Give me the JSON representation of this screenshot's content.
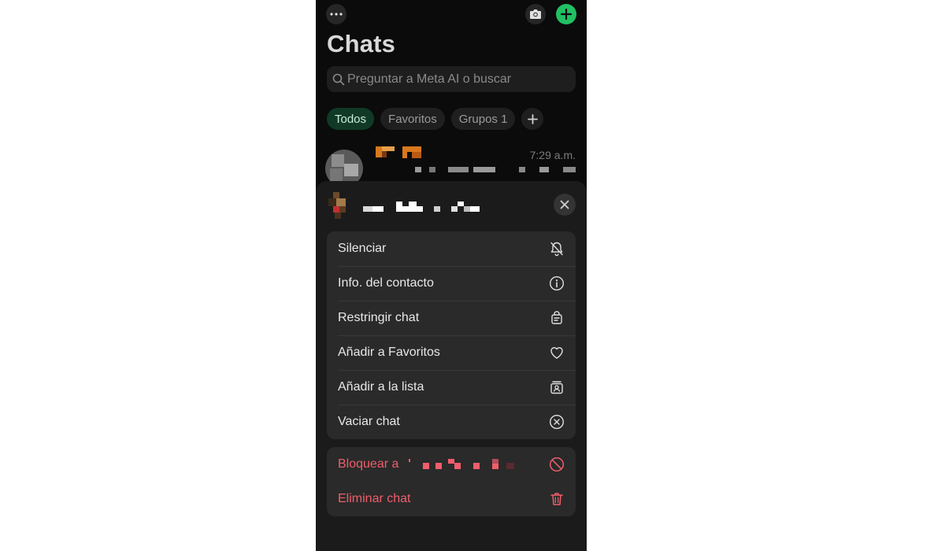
{
  "header": {
    "more_icon": "ellipsis-icon",
    "camera_icon": "camera-icon",
    "new_chat_icon": "plus-icon",
    "title": "Chats",
    "accent_color": "#21c063"
  },
  "search": {
    "placeholder": "Preguntar a Meta AI o buscar",
    "icon": "search-icon"
  },
  "filters": [
    {
      "label": "Todos",
      "active": true
    },
    {
      "label": "Favoritos",
      "active": false
    },
    {
      "label": "Grupos 1",
      "active": false
    },
    {
      "label": "+",
      "active": false
    }
  ],
  "chat_list": [
    {
      "time": "7:29 a.m."
    }
  ],
  "context_menu": {
    "close_icon": "close-icon",
    "options": [
      {
        "label": "Silenciar",
        "icon": "bell-off-icon"
      },
      {
        "label": "Info. del contacto",
        "icon": "info-icon"
      },
      {
        "label": "Restringir chat",
        "icon": "restrict-chat-icon"
      },
      {
        "label": "Añadir a Favoritos",
        "icon": "heart-icon"
      },
      {
        "label": "Añadir a la lista",
        "icon": "list-contact-icon"
      },
      {
        "label": "Vaciar chat",
        "icon": "clear-circle-icon"
      }
    ],
    "danger_options": [
      {
        "label": "Bloquear a",
        "icon": "block-icon"
      },
      {
        "label": "Eliminar chat",
        "icon": "trash-icon"
      }
    ],
    "danger_color": "#f05d6b"
  }
}
